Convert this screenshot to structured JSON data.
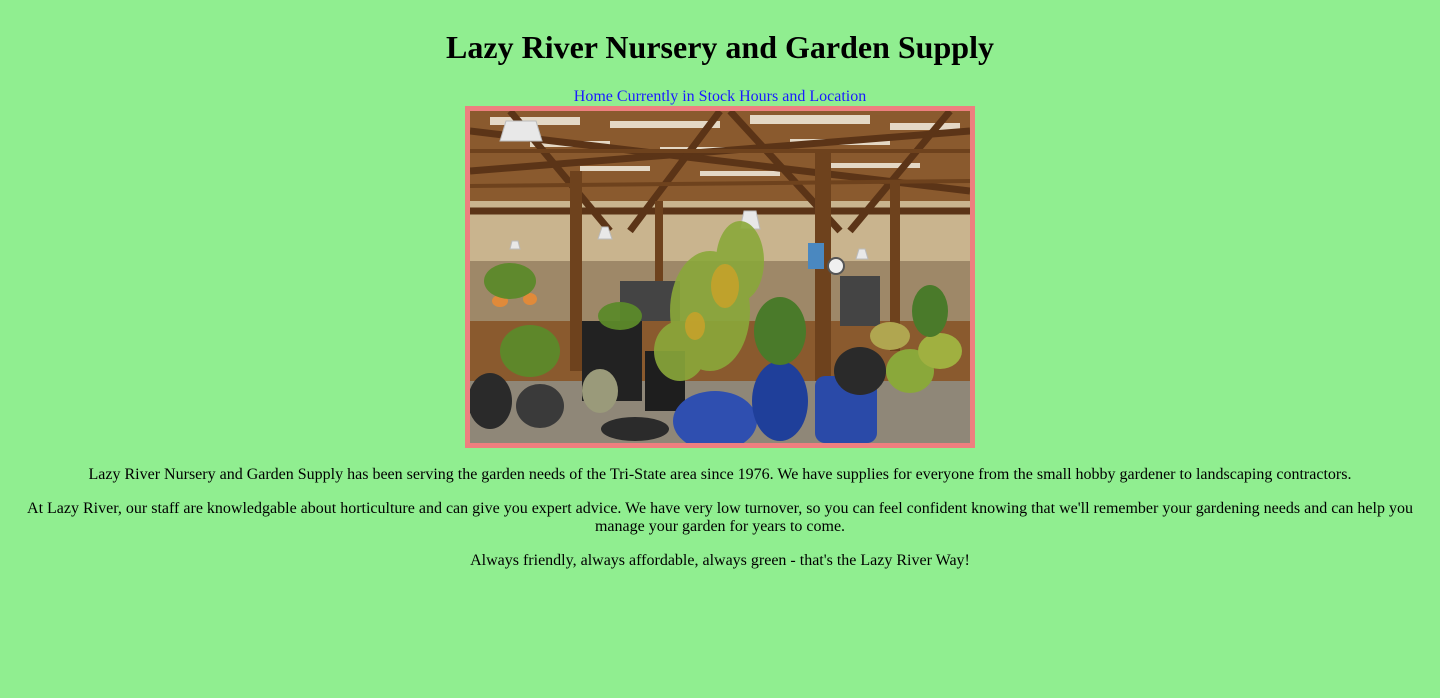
{
  "header": {
    "title": "Lazy River Nursery and Garden Supply"
  },
  "nav": {
    "items": [
      {
        "label": "Home"
      },
      {
        "label": "Currently in Stock"
      },
      {
        "label": "Hours and Location"
      }
    ]
  },
  "hero_image": {
    "icon": "garden-center-photo",
    "border_color": "#ee7f7f"
  },
  "main": {
    "paragraphs": [
      "Lazy River Nursery and Garden Supply has been serving the garden needs of the Tri-State area since 1976. We have supplies for everyone from the small hobby gardener to landscaping contractors.",
      "At Lazy River, our staff are knowledgable about horticulture and can give you expert advice. We have very low turnover, so you can feel confident knowing that we'll remember your gardening needs and can help you manage your garden for years to come.",
      "Always friendly, always affordable, always green - that's the Lazy River Way!"
    ]
  },
  "colors": {
    "background": "#90ee90",
    "link": "#1a1aff"
  }
}
